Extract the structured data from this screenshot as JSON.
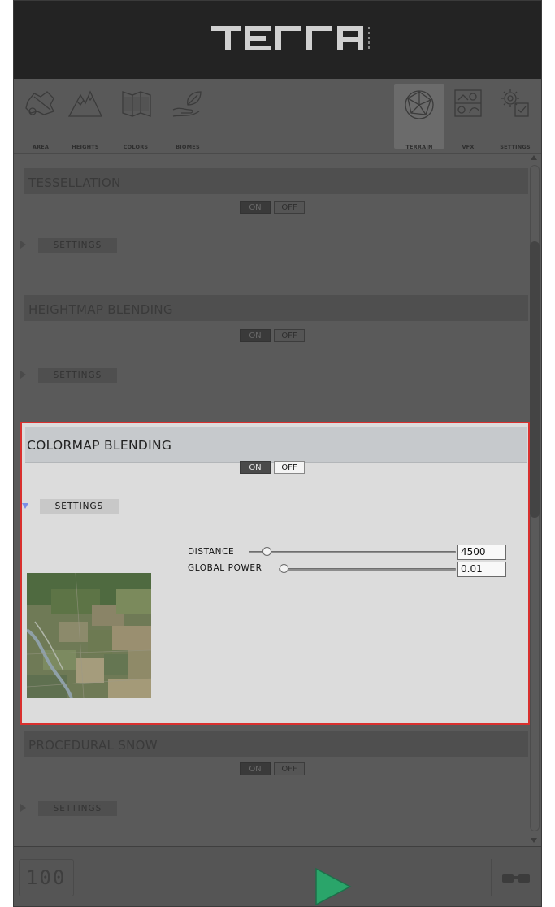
{
  "app": {
    "logo_text": "TERRA",
    "logo_sub": "WORLD"
  },
  "toolbar": {
    "tools": [
      {
        "label": "AREA",
        "icon": "area-icon"
      },
      {
        "label": "HEIGHTS",
        "icon": "mountain-icon"
      },
      {
        "label": "COLORS",
        "icon": "map-icon"
      },
      {
        "label": "BIOMES",
        "icon": "leaf-hand-icon"
      },
      {
        "label": "TERRAIN",
        "icon": "terrain-mesh-icon",
        "active": true
      },
      {
        "label": "VFX",
        "icon": "vfx-icon"
      },
      {
        "label": "SETTINGS",
        "icon": "gears-icon"
      }
    ]
  },
  "sections": {
    "tessellation": {
      "title": "TESSELLATION",
      "on": "ON",
      "off": "OFF",
      "settings": "SETTINGS"
    },
    "heightmap": {
      "title": "HEIGHTMAP BLENDING",
      "on": "ON",
      "off": "OFF",
      "settings": "SETTINGS"
    },
    "colormap": {
      "title": "COLORMAP BLENDING",
      "on": "ON",
      "off": "OFF",
      "settings": "SETTINGS",
      "params": {
        "distance": {
          "label": "DISTANCE",
          "value": "4500"
        },
        "global_power": {
          "label": "GLOBAL POWER",
          "value": "0.01"
        }
      }
    },
    "snow": {
      "title": "PROCEDURAL SNOW",
      "on": "ON",
      "off": "OFF",
      "settings": "SETTINGS"
    }
  },
  "bottom": {
    "counter": "100"
  },
  "colors": {
    "highlight_border": "#d9302e",
    "play": "#2aa56a",
    "expanded_arrow": "#7a8fe6"
  }
}
